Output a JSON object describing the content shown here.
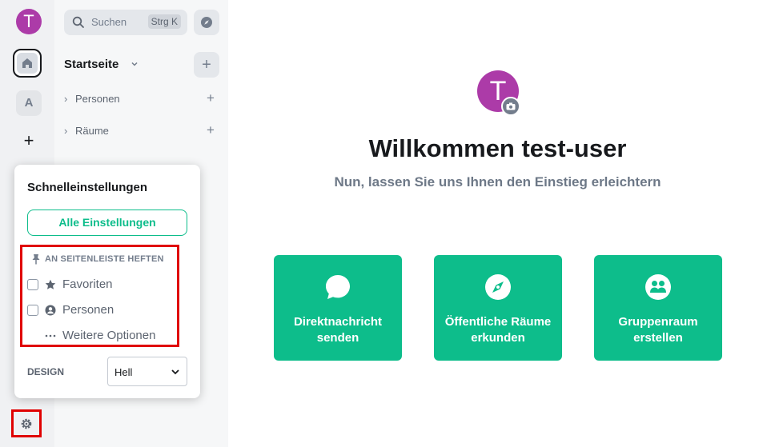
{
  "spacebar": {
    "user_initial": "T",
    "space_a_initial": "A",
    "add_space": "+"
  },
  "roomlist": {
    "search_label": "Suchen",
    "search_shortcut": "Strg K",
    "home_title": "Startseite",
    "add_button": "+",
    "sections": [
      {
        "label": "Personen"
      },
      {
        "label": "Räume"
      }
    ]
  },
  "main": {
    "avatar_initial": "T",
    "welcome": "Willkommen test-user",
    "subtitle": "Nun, lassen Sie uns Ihnen den Einstieg erleichtern",
    "cards": [
      {
        "line1": "Direktnachricht",
        "line2": "senden",
        "icon": "chat-bubble-icon"
      },
      {
        "line1": "Öffentliche Räume",
        "line2": "erkunden",
        "icon": "compass-icon"
      },
      {
        "line1": "Gruppenraum",
        "line2": "erstellen",
        "icon": "group-icon"
      }
    ]
  },
  "quick_settings": {
    "title": "Schnelleinstellungen",
    "all_settings": "Alle Einstellungen",
    "pin_heading": "AN SEITENLEISTE HEFTEN",
    "pin_items": [
      {
        "label": "Favoriten",
        "checked": false,
        "icon": "star-icon"
      },
      {
        "label": "Personen",
        "checked": false,
        "icon": "person-icon"
      },
      {
        "label": "Weitere Optionen",
        "icon": "ellipsis-icon"
      }
    ],
    "design_label": "DESIGN",
    "design_value": "Hell"
  },
  "colors": {
    "accent": "#0dbd8b",
    "avatar": "#ac3ba8",
    "highlight": "#e00000"
  }
}
